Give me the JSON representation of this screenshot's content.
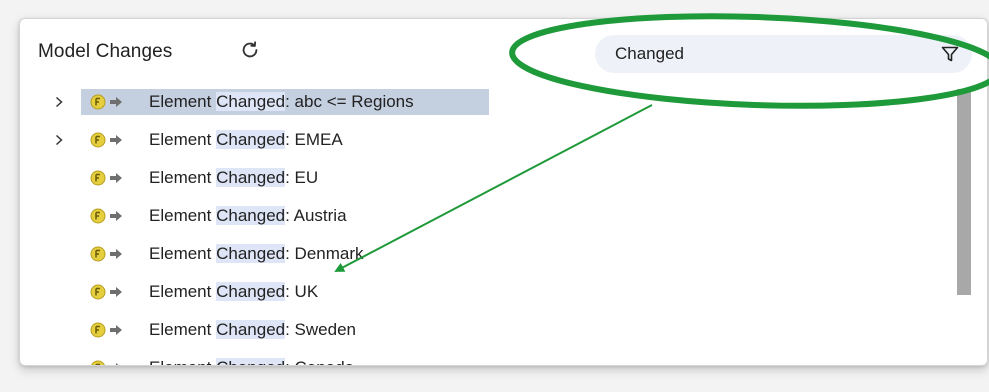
{
  "panel": {
    "title": "Model Changes",
    "refresh_icon": "refresh-icon",
    "filter": {
      "value": "Changed",
      "icon": "filter-funnel-icon"
    }
  },
  "rows": [
    {
      "prefix": "Element ",
      "match": "Changed",
      "suffix": ": abc <= Regions",
      "expandable": true,
      "selected": true
    },
    {
      "prefix": "Element ",
      "match": "Changed",
      "suffix": ": EMEA",
      "expandable": true,
      "selected": false
    },
    {
      "prefix": "Element ",
      "match": "Changed",
      "suffix": ": EU",
      "expandable": false,
      "selected": false
    },
    {
      "prefix": "Element ",
      "match": "Changed",
      "suffix": ": Austria",
      "expandable": false,
      "selected": false
    },
    {
      "prefix": "Element ",
      "match": "Changed",
      "suffix": ": Denmark",
      "expandable": false,
      "selected": false
    },
    {
      "prefix": "Element ",
      "match": "Changed",
      "suffix": ": UK",
      "expandable": false,
      "selected": false
    },
    {
      "prefix": "Element ",
      "match": "Changed",
      "suffix": ": Sweden",
      "expandable": false,
      "selected": false
    },
    {
      "prefix": "Element ",
      "match": "Changed",
      "suffix": ": Canada",
      "expandable": false,
      "selected": false
    }
  ],
  "icons": {
    "row_type": "feature-badge-icon",
    "row_arrow": "arrow-right-icon",
    "expand": "chevron-right-icon"
  },
  "colors": {
    "selection": "#c4cfdf",
    "match_highlight": "#dde5f6",
    "annotation_green": "#1e9a3a",
    "feature_badge": "#e6cf3e"
  }
}
